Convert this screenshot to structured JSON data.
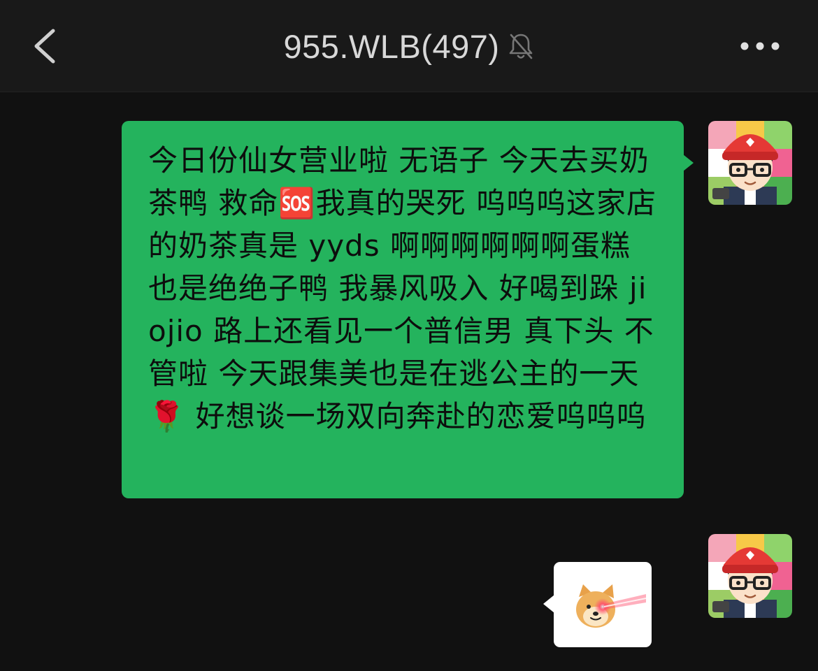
{
  "header": {
    "title": "955.WLB(497)",
    "back_icon": "chevron-left-icon",
    "mute_icon": "bell-off-icon",
    "more_icon": "more-horizontal-icon"
  },
  "messages": [
    {
      "sender": "self",
      "type": "text",
      "text": "今日份仙女营业啦 无语子 今天去买奶茶鸭 救命🆘我真的哭死 呜呜呜这家店的奶茶真是 yyds 啊啊啊啊啊啊蛋糕也是绝绝子鸭 我暴风吸入 好喝到跺 jiojio 路上还看见一个普信男 真下头 不管啦 今天跟集美也是在逃公主的一天🌹 好想谈一场双向奔赴的恋爱呜呜呜"
    },
    {
      "sender": "self",
      "type": "sticker",
      "sticker": "doge-laser-eyes-sticker"
    }
  ],
  "colors": {
    "background": "#111111",
    "header_bg": "#191919",
    "bubble_green": "#24b35d",
    "title_text": "#d8d8d8"
  }
}
